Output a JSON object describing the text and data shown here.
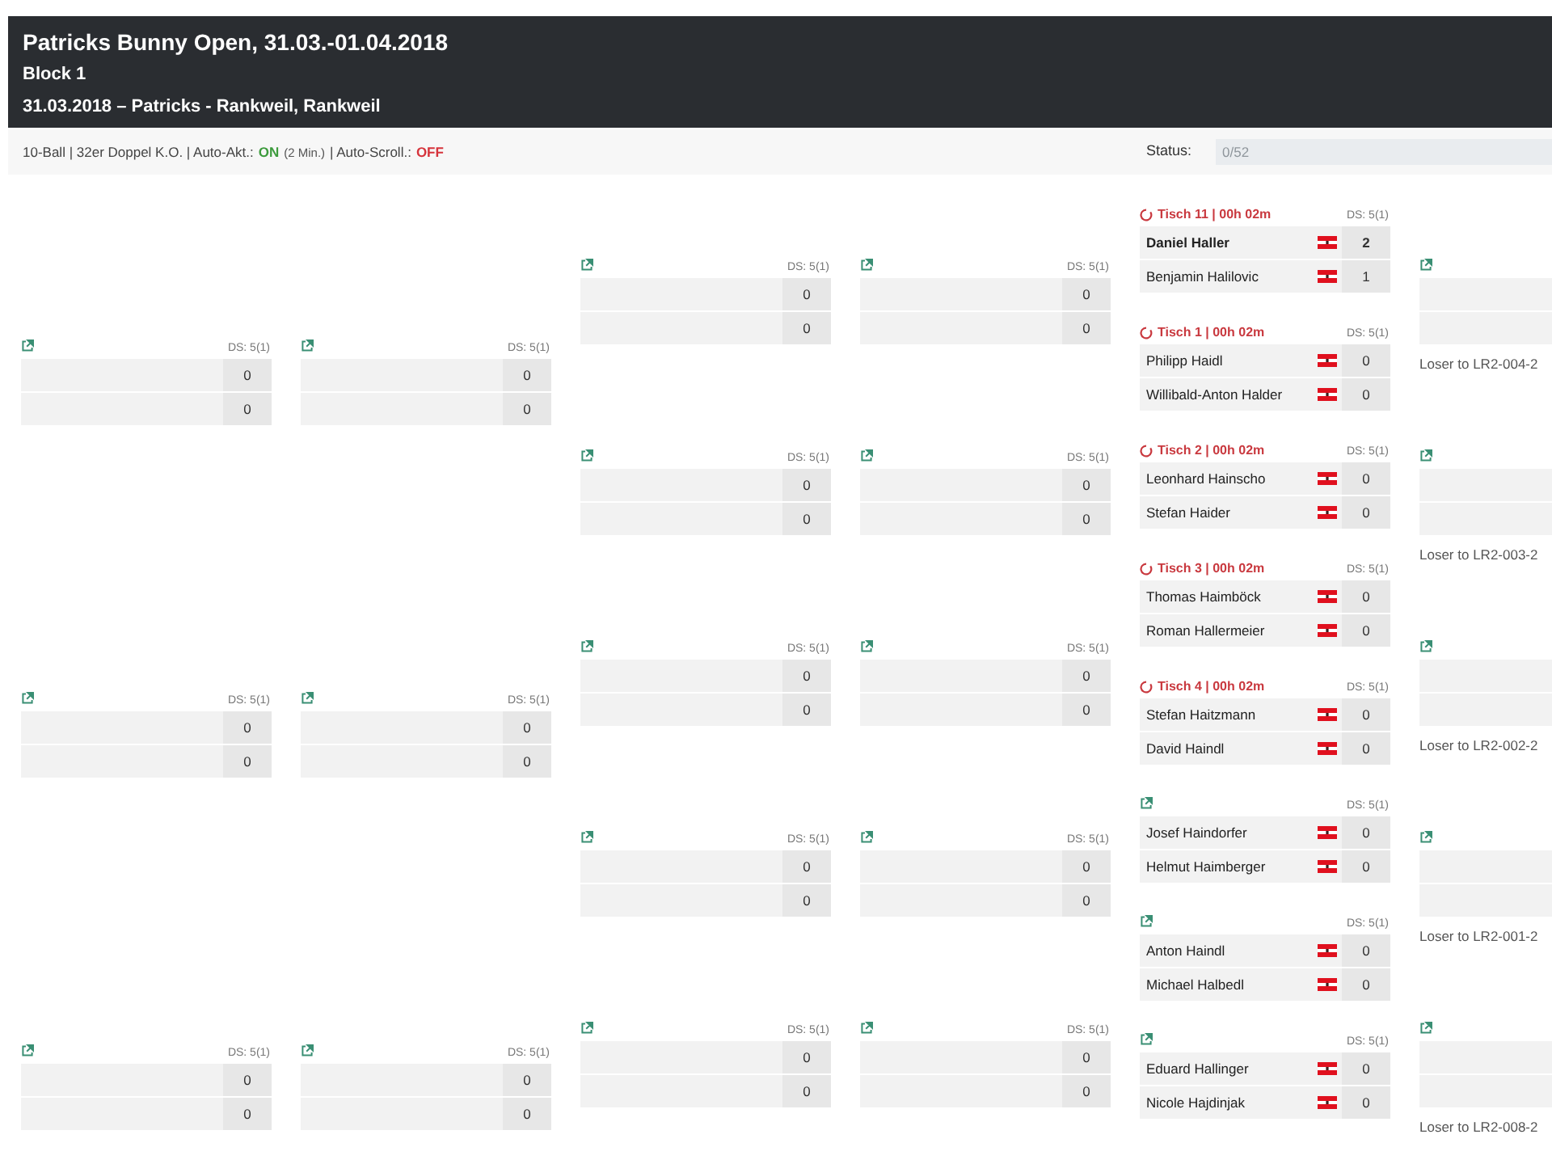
{
  "header": {
    "title": "Patricks Bunny Open, 31.03.-01.04.2018",
    "block": "Block 1",
    "subtitle": "31.03.2018 – Patricks - Rankweil, Rankweil"
  },
  "settings_line": [
    {
      "kind": "text",
      "text": "10-Ball | 32er Doppel K.O. | Auto-Akt.:"
    },
    {
      "kind": "toggle",
      "text": "ON",
      "on": true
    },
    {
      "kind": "note",
      "text": "(2 Min.)"
    },
    {
      "kind": "text",
      "text": "| Auto-Scroll.:"
    },
    {
      "kind": "toggle",
      "text": "OFF",
      "on": false
    }
  ],
  "status": {
    "label": "Status:",
    "text": "0/52",
    "level": 0
  },
  "bracket": {
    "columns": [
      {
        "matches": [
          {
            "ds": "DS: 5(1)",
            "players": [
              {
                "score": "0",
                "winner": false
              },
              {
                "score": "0",
                "winner": false
              }
            ]
          },
          {
            "ds": "DS: 5(1)",
            "players": [
              {
                "score": "0",
                "winner": false
              },
              {
                "score": "0",
                "winner": false
              }
            ]
          },
          {
            "ds": "DS: 5(1)",
            "players": [
              {
                "score": "0",
                "winner": false
              },
              {
                "score": "0",
                "winner": false
              }
            ]
          }
        ]
      },
      {
        "matches": [
          {
            "ds": "DS: 5(1)",
            "players": [
              {
                "score": "0",
                "winner": false
              },
              {
                "score": "0",
                "winner": false
              }
            ]
          },
          {
            "ds": "DS: 5(1)",
            "players": [
              {
                "score": "0",
                "winner": false
              },
              {
                "score": "0",
                "winner": false
              }
            ]
          },
          {
            "ds": "DS: 5(1)",
            "players": [
              {
                "score": "0",
                "winner": false
              },
              {
                "score": "0",
                "winner": false
              }
            ]
          }
        ]
      },
      {
        "matches": [
          {
            "ds": "DS: 5(1)",
            "players": [
              {
                "score": "0",
                "winner": false
              },
              {
                "score": "0",
                "winner": false
              }
            ]
          },
          {
            "ds": "DS: 5(1)",
            "players": [
              {
                "score": "0",
                "winner": false
              },
              {
                "score": "0",
                "winner": false
              }
            ]
          },
          {
            "ds": "DS: 5(1)",
            "players": [
              {
                "score": "0",
                "winner": false
              },
              {
                "score": "0",
                "winner": false
              }
            ]
          },
          {
            "ds": "DS: 5(1)",
            "players": [
              {
                "score": "0",
                "winner": false
              },
              {
                "score": "0",
                "winner": false
              }
            ]
          },
          {
            "ds": "DS: 5(1)",
            "players": [
              {
                "score": "0",
                "winner": false
              },
              {
                "score": "0",
                "winner": false
              }
            ]
          }
        ]
      },
      {
        "matches": [
          {
            "ds": "DS: 5(1)",
            "players": [
              {
                "score": "0",
                "winner": false
              },
              {
                "score": "0",
                "winner": false
              }
            ]
          },
          {
            "ds": "DS: 5(1)",
            "players": [
              {
                "score": "0",
                "winner": false
              },
              {
                "score": "0",
                "winner": false
              }
            ]
          },
          {
            "ds": "DS: 5(1)",
            "players": [
              {
                "score": "0",
                "winner": false
              },
              {
                "score": "0",
                "winner": false
              }
            ]
          },
          {
            "ds": "DS: 5(1)",
            "players": [
              {
                "score": "0",
                "winner": false
              },
              {
                "score": "0",
                "winner": false
              }
            ]
          },
          {
            "ds": "DS: 5(1)",
            "players": [
              {
                "score": "0",
                "winner": false
              },
              {
                "score": "0",
                "winner": false
              }
            ]
          }
        ]
      },
      {
        "matches": [
          {
            "table": "Tisch 11 | 00h 02m",
            "ds": "DS: 5(1)",
            "players": [
              {
                "name": "Daniel Haller",
                "score": "2",
                "winner": true
              },
              {
                "name": "Benjamin Halilovic",
                "score": "1",
                "winner": false
              }
            ]
          },
          {
            "table": "Tisch 1 | 00h 02m",
            "ds": "DS: 5(1)",
            "players": [
              {
                "name": "Philipp Haidl",
                "score": "0",
                "winner": false
              },
              {
                "name": "Willibald-Anton Halder",
                "score": "0",
                "winner": false
              }
            ]
          },
          {
            "table": "Tisch 2 | 00h 02m",
            "ds": "DS: 5(1)",
            "players": [
              {
                "name": "Leonhard Hainscho",
                "score": "0",
                "winner": false
              },
              {
                "name": "Stefan Haider",
                "score": "0",
                "winner": false
              }
            ]
          },
          {
            "table": "Tisch 3 | 00h 02m",
            "ds": "DS: 5(1)",
            "players": [
              {
                "name": "Thomas Haimböck",
                "score": "0",
                "winner": false
              },
              {
                "name": "Roman Hallermeier",
                "score": "0",
                "winner": false
              }
            ]
          },
          {
            "table": "Tisch 4 | 00h 02m",
            "ds": "DS: 5(1)",
            "players": [
              {
                "name": "Stefan Haitzmann",
                "score": "0",
                "winner": false
              },
              {
                "name": "David Haindl",
                "score": "0",
                "winner": false
              }
            ]
          },
          {
            "ds": "DS: 5(1)",
            "players": [
              {
                "name": "Josef Haindorfer",
                "score": "0",
                "winner": false
              },
              {
                "name": "Helmut Haimberger",
                "score": "0",
                "winner": false
              }
            ]
          },
          {
            "ds": "DS: 5(1)",
            "players": [
              {
                "name": "Anton Haindl",
                "score": "0",
                "winner": false
              },
              {
                "name": "Michael Halbedl",
                "score": "0",
                "winner": false
              }
            ]
          },
          {
            "ds": "DS: 5(1)",
            "players": [
              {
                "name": "Eduard Hallinger",
                "score": "0",
                "winner": false
              },
              {
                "name": "Nicole Hajdinjak",
                "score": "0",
                "winner": false
              }
            ]
          }
        ]
      },
      {
        "matches": [
          {
            "loser_to": "Loser to LR2-004-2"
          },
          {
            "loser_to": "Loser to LR2-003-2"
          },
          {
            "loser_to": "Loser to LR2-002-2"
          },
          {
            "loser_to": "Loser to LR2-001-2"
          },
          {
            "loser_to": "Loser to LR2-008-2"
          }
        ]
      }
    ]
  }
}
